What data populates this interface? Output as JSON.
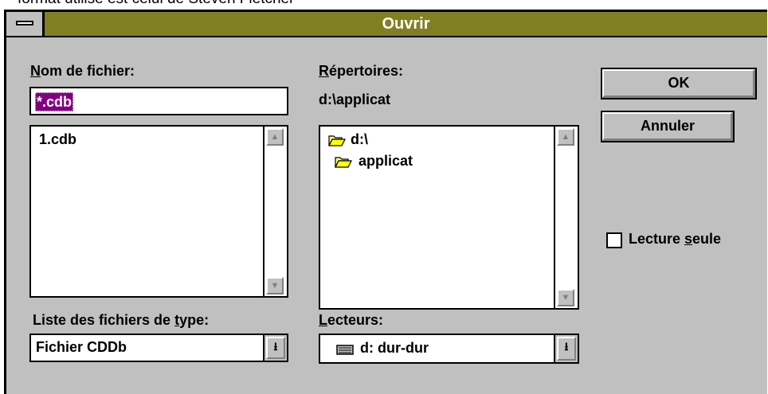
{
  "above_text": "format utilisé est celui de Steven Fletcher",
  "window": {
    "title": "Ouvrir"
  },
  "filename": {
    "label_hotkey": "N",
    "label_rest": "om de fichier:",
    "value": "*.cdb",
    "files": [
      "1.cdb"
    ]
  },
  "file_types": {
    "label_pre": "Liste des fichiers de ",
    "label_hotkey": "t",
    "label_post": "ype:",
    "selected": "Fichier CDDb"
  },
  "directories": {
    "label_hotkey": "R",
    "label_rest": "épertoires:",
    "current_path": "d:\\applicat",
    "tree": [
      "d:\\",
      "applicat"
    ]
  },
  "drives": {
    "label_hotkey": "L",
    "label_rest": "ecteurs:",
    "selected": "d: dur-dur"
  },
  "buttons": {
    "ok": "OK",
    "cancel": "Annuler"
  },
  "readonly": {
    "label_pre": "Lecture ",
    "label_hotkey": "s",
    "label_post": "eule",
    "checked": false
  },
  "colors": {
    "titlebar": "#808022",
    "selection": "#800080",
    "dialog_bg": "#c0c0c0"
  }
}
